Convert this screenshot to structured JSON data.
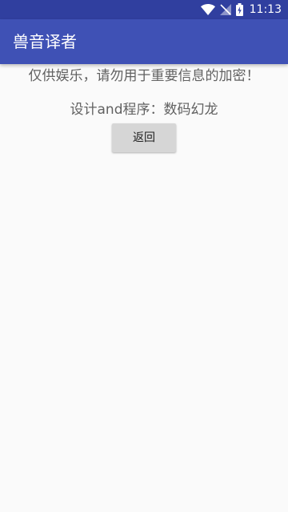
{
  "status_bar": {
    "time": "11:13",
    "icons": [
      "wifi-icon",
      "no-signal-icon",
      "battery-charging-icon"
    ],
    "background": "#303f9f"
  },
  "app_bar": {
    "title": "兽音译者",
    "background": "#3f51b5"
  },
  "main": {
    "notice": "仅供娱乐，请勿用于重要信息的加密！",
    "credit": "设计and程序：数码幻龙",
    "back_button_label": "返回"
  }
}
